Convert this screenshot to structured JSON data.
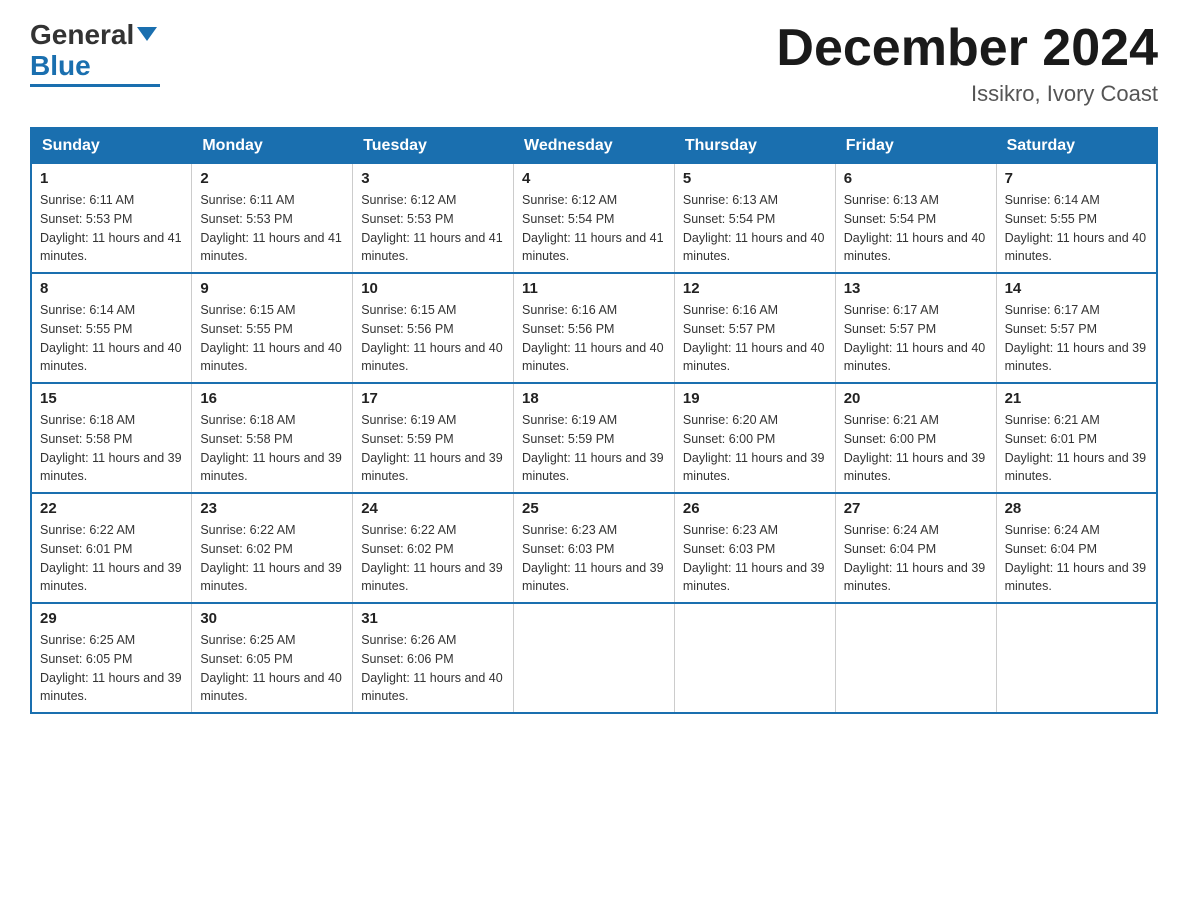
{
  "header": {
    "logo_general": "General",
    "logo_blue": "Blue",
    "month_year": "December 2024",
    "location": "Issikro, Ivory Coast"
  },
  "weekdays": [
    "Sunday",
    "Monday",
    "Tuesday",
    "Wednesday",
    "Thursday",
    "Friday",
    "Saturday"
  ],
  "weeks": [
    [
      {
        "day": "1",
        "sunrise": "6:11 AM",
        "sunset": "5:53 PM",
        "daylight": "11 hours and 41 minutes."
      },
      {
        "day": "2",
        "sunrise": "6:11 AM",
        "sunset": "5:53 PM",
        "daylight": "11 hours and 41 minutes."
      },
      {
        "day": "3",
        "sunrise": "6:12 AM",
        "sunset": "5:53 PM",
        "daylight": "11 hours and 41 minutes."
      },
      {
        "day": "4",
        "sunrise": "6:12 AM",
        "sunset": "5:54 PM",
        "daylight": "11 hours and 41 minutes."
      },
      {
        "day": "5",
        "sunrise": "6:13 AM",
        "sunset": "5:54 PM",
        "daylight": "11 hours and 40 minutes."
      },
      {
        "day": "6",
        "sunrise": "6:13 AM",
        "sunset": "5:54 PM",
        "daylight": "11 hours and 40 minutes."
      },
      {
        "day": "7",
        "sunrise": "6:14 AM",
        "sunset": "5:55 PM",
        "daylight": "11 hours and 40 minutes."
      }
    ],
    [
      {
        "day": "8",
        "sunrise": "6:14 AM",
        "sunset": "5:55 PM",
        "daylight": "11 hours and 40 minutes."
      },
      {
        "day": "9",
        "sunrise": "6:15 AM",
        "sunset": "5:55 PM",
        "daylight": "11 hours and 40 minutes."
      },
      {
        "day": "10",
        "sunrise": "6:15 AM",
        "sunset": "5:56 PM",
        "daylight": "11 hours and 40 minutes."
      },
      {
        "day": "11",
        "sunrise": "6:16 AM",
        "sunset": "5:56 PM",
        "daylight": "11 hours and 40 minutes."
      },
      {
        "day": "12",
        "sunrise": "6:16 AM",
        "sunset": "5:57 PM",
        "daylight": "11 hours and 40 minutes."
      },
      {
        "day": "13",
        "sunrise": "6:17 AM",
        "sunset": "5:57 PM",
        "daylight": "11 hours and 40 minutes."
      },
      {
        "day": "14",
        "sunrise": "6:17 AM",
        "sunset": "5:57 PM",
        "daylight": "11 hours and 39 minutes."
      }
    ],
    [
      {
        "day": "15",
        "sunrise": "6:18 AM",
        "sunset": "5:58 PM",
        "daylight": "11 hours and 39 minutes."
      },
      {
        "day": "16",
        "sunrise": "6:18 AM",
        "sunset": "5:58 PM",
        "daylight": "11 hours and 39 minutes."
      },
      {
        "day": "17",
        "sunrise": "6:19 AM",
        "sunset": "5:59 PM",
        "daylight": "11 hours and 39 minutes."
      },
      {
        "day": "18",
        "sunrise": "6:19 AM",
        "sunset": "5:59 PM",
        "daylight": "11 hours and 39 minutes."
      },
      {
        "day": "19",
        "sunrise": "6:20 AM",
        "sunset": "6:00 PM",
        "daylight": "11 hours and 39 minutes."
      },
      {
        "day": "20",
        "sunrise": "6:21 AM",
        "sunset": "6:00 PM",
        "daylight": "11 hours and 39 minutes."
      },
      {
        "day": "21",
        "sunrise": "6:21 AM",
        "sunset": "6:01 PM",
        "daylight": "11 hours and 39 minutes."
      }
    ],
    [
      {
        "day": "22",
        "sunrise": "6:22 AM",
        "sunset": "6:01 PM",
        "daylight": "11 hours and 39 minutes."
      },
      {
        "day": "23",
        "sunrise": "6:22 AM",
        "sunset": "6:02 PM",
        "daylight": "11 hours and 39 minutes."
      },
      {
        "day": "24",
        "sunrise": "6:22 AM",
        "sunset": "6:02 PM",
        "daylight": "11 hours and 39 minutes."
      },
      {
        "day": "25",
        "sunrise": "6:23 AM",
        "sunset": "6:03 PM",
        "daylight": "11 hours and 39 minutes."
      },
      {
        "day": "26",
        "sunrise": "6:23 AM",
        "sunset": "6:03 PM",
        "daylight": "11 hours and 39 minutes."
      },
      {
        "day": "27",
        "sunrise": "6:24 AM",
        "sunset": "6:04 PM",
        "daylight": "11 hours and 39 minutes."
      },
      {
        "day": "28",
        "sunrise": "6:24 AM",
        "sunset": "6:04 PM",
        "daylight": "11 hours and 39 minutes."
      }
    ],
    [
      {
        "day": "29",
        "sunrise": "6:25 AM",
        "sunset": "6:05 PM",
        "daylight": "11 hours and 39 minutes."
      },
      {
        "day": "30",
        "sunrise": "6:25 AM",
        "sunset": "6:05 PM",
        "daylight": "11 hours and 40 minutes."
      },
      {
        "day": "31",
        "sunrise": "6:26 AM",
        "sunset": "6:06 PM",
        "daylight": "11 hours and 40 minutes."
      },
      null,
      null,
      null,
      null
    ]
  ],
  "labels": {
    "sunrise": "Sunrise:",
    "sunset": "Sunset:",
    "daylight": "Daylight:"
  }
}
